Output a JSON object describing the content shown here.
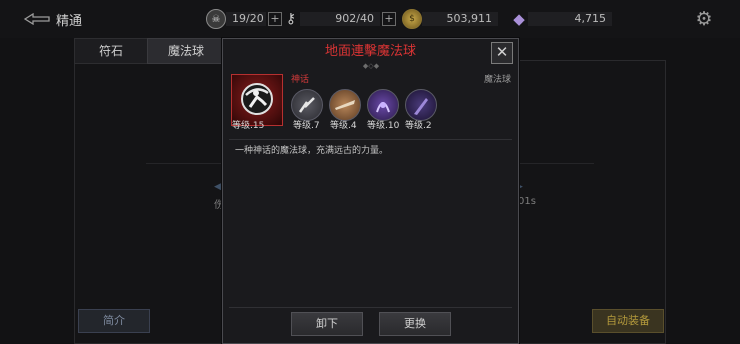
{
  "header": {
    "back_label": "精通"
  },
  "resources": [
    {
      "icon": "skull-coin-icon",
      "value": "19/20",
      "has_plus": true
    },
    {
      "icon": "key-icon",
      "value": "902/40",
      "has_plus": true
    },
    {
      "icon": "gold-coin-icon",
      "value": "503,911",
      "has_plus": false
    },
    {
      "icon": "crystal-icon",
      "value": "4,715",
      "has_plus": false
    }
  ],
  "tabs": [
    {
      "label": "符石"
    },
    {
      "label": "魔法球"
    }
  ],
  "background": {
    "left_text": "伤",
    "right_text": "01s",
    "intro_button": "简介",
    "auto_equip_button": "自动装备"
  },
  "dialog": {
    "title": "地面連擊魔法球",
    "rarity": "神话",
    "category": "魔法球",
    "main_level": "等级.15",
    "sub_levels": [
      "等级.7",
      "等级.4",
      "等级.10",
      "等级.2"
    ],
    "description": "一种神话的魔法球，充满远古的力量。",
    "unequip_button": "卸下",
    "replace_button": "更换"
  },
  "colors": {
    "title_red": "#d93434",
    "background": "#121214"
  }
}
